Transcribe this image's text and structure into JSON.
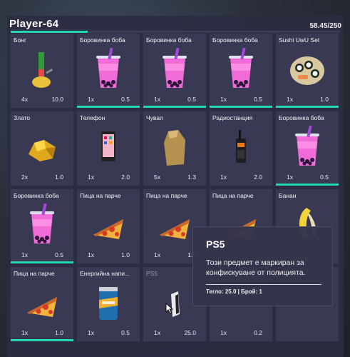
{
  "header": {
    "title": "Player-64",
    "weight_text": "58.45/250",
    "weight_fraction": 0.2338
  },
  "slots": [
    {
      "name": "Бонг",
      "count": "4x",
      "weight": "10.0",
      "icon": "bong-icon",
      "bar": 0
    },
    {
      "name": "Боровинка боба",
      "count": "1x",
      "weight": "0.5",
      "icon": "boba-tea-icon",
      "bar": 1
    },
    {
      "name": "Боровинка боба",
      "count": "1x",
      "weight": "0.5",
      "icon": "boba-tea-icon",
      "bar": 1
    },
    {
      "name": "Боровинка боба",
      "count": "1x",
      "weight": "0.5",
      "icon": "boba-tea-icon",
      "bar": 1
    },
    {
      "name": "Sushi UwU Set",
      "count": "1x",
      "weight": "1.0",
      "icon": "sushi-set-icon",
      "bar": 1
    },
    {
      "name": "Злато",
      "count": "2x",
      "weight": "1.0",
      "icon": "gold-icon",
      "bar": 0
    },
    {
      "name": "Телефон",
      "count": "1x",
      "weight": "2.0",
      "icon": "phone-icon",
      "bar": 0
    },
    {
      "name": "Чувал",
      "count": "5x",
      "weight": "1.3",
      "icon": "sack-icon",
      "bar": 0
    },
    {
      "name": "Радиостанция",
      "count": "1x",
      "weight": "2.0",
      "icon": "radio-icon",
      "bar": 0
    },
    {
      "name": "Боровинка боба",
      "count": "1x",
      "weight": "0.5",
      "icon": "boba-tea-icon",
      "bar": 1
    },
    {
      "name": "Боровинка боба",
      "count": "1x",
      "weight": "0.5",
      "icon": "boba-tea-icon",
      "bar": 1
    },
    {
      "name": "Пица на парче",
      "count": "1x",
      "weight": "1.0",
      "icon": "pizza-slice-icon",
      "bar": 0
    },
    {
      "name": "Пица на парче",
      "count": "1x",
      "weight": "1.0",
      "icon": "pizza-slice-icon",
      "bar": 0
    },
    {
      "name": "Пица на парче",
      "count": "",
      "weight": "",
      "icon": "pizza-slice-icon",
      "bar": 0
    },
    {
      "name": "Банан",
      "count": "",
      "weight": "",
      "icon": "banana-icon",
      "bar": 0
    },
    {
      "name": "Пица на парче",
      "count": "1x",
      "weight": "1.0",
      "icon": "pizza-slice-icon",
      "bar": 1
    },
    {
      "name": "Енергийна напи...",
      "count": "1x",
      "weight": "0.5",
      "icon": "energy-drink-icon",
      "bar": 0
    },
    {
      "name": "PS5",
      "count": "1x",
      "weight": "25.0",
      "icon": "ps5-icon",
      "bar": 0,
      "muted": true
    },
    {
      "name": "",
      "count": "1x",
      "weight": "0.2",
      "icon": "none",
      "bar": 0
    },
    {
      "name": "",
      "count": "",
      "weight": "",
      "icon": "none",
      "bar": 0
    }
  ],
  "tooltip": {
    "title": "PS5",
    "description": "Този предмет е маркиран за конфискуване от полицията.",
    "meta": "Тегло: 25.0 | Брой: 1"
  },
  "colors": {
    "accent": "#23d6b0",
    "panel": "#2c2c42",
    "slot": "#3a3a54"
  }
}
